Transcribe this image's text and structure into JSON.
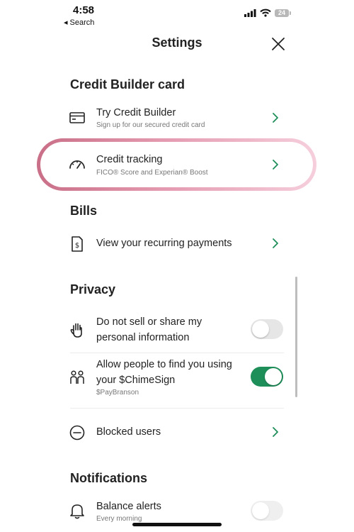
{
  "status_bar": {
    "time": "4:58",
    "back_label": "Search",
    "battery": "24"
  },
  "header": {
    "title": "Settings"
  },
  "sections": {
    "credit_builder": {
      "heading": "Credit Builder card",
      "try_title": "Try Credit Builder",
      "try_sub": "Sign up for our secured credit card",
      "tracking_title": "Credit tracking",
      "tracking_sub": "FICO® Score and Experian® Boost"
    },
    "bills": {
      "heading": "Bills",
      "recurring_title": "View your recurring payments"
    },
    "privacy": {
      "heading": "Privacy",
      "do_not_sell_line1": "Do not sell or share my",
      "do_not_sell_line2": "personal information",
      "do_not_sell_enabled": false,
      "allow_find_line1": "Allow people to find you using",
      "allow_find_line2": "your $ChimeSign",
      "allow_find_sub": "$PayBranson",
      "allow_find_enabled": true,
      "blocked_title": "Blocked users"
    },
    "notifications": {
      "heading": "Notifications",
      "balance_title": "Balance alerts",
      "balance_sub": "Every morning",
      "balance_enabled": false
    }
  },
  "colors": {
    "accent_green": "#1f8f5a",
    "highlight_pink": "#d97b96"
  }
}
